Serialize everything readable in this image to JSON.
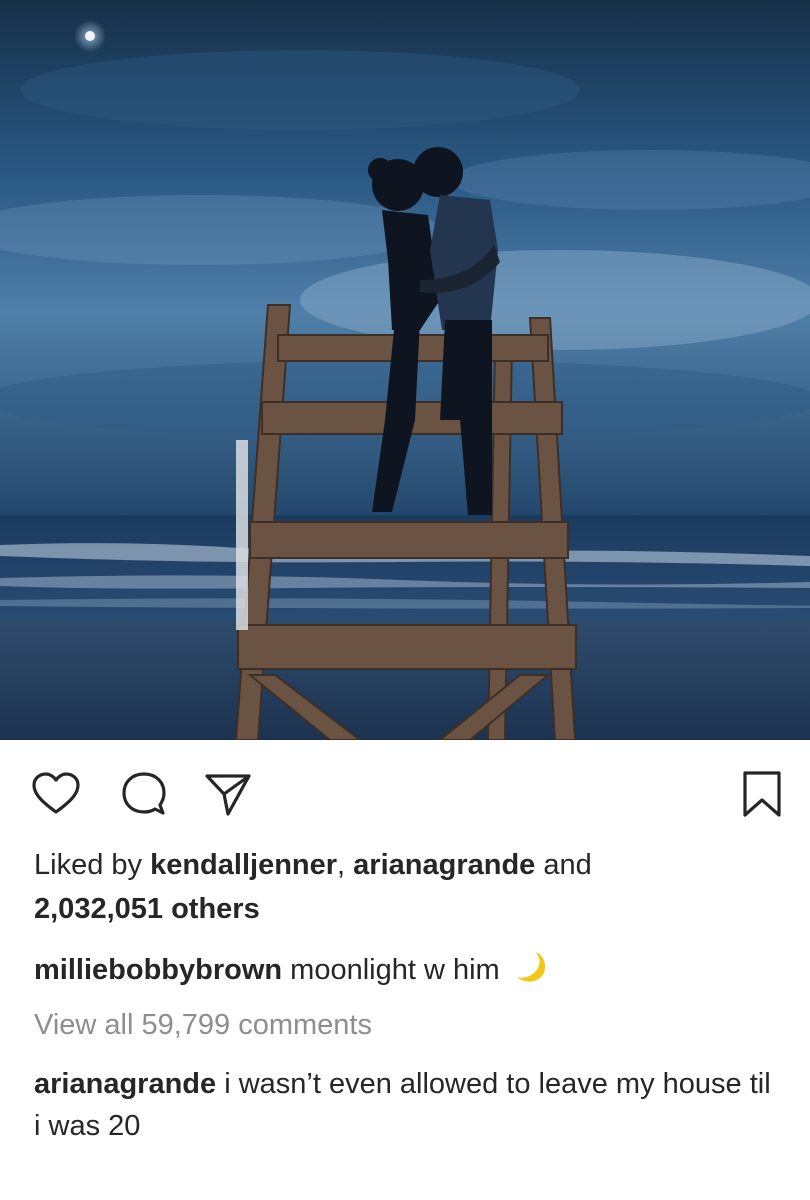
{
  "post": {
    "image_alt": "Couple kissing on a lifeguard chair at the beach under a moonlit sky"
  },
  "actions": {
    "like_icon": "heart-icon",
    "comment_icon": "comment-icon",
    "share_icon": "paper-plane-icon",
    "save_icon": "bookmark-icon"
  },
  "likes": {
    "prefix": "Liked by ",
    "user1": "kendalljenner",
    "separator": ", ",
    "user2": "arianagrande",
    "conjunction": " and",
    "others": "2,032,051 others"
  },
  "caption": {
    "username": "milliebobbybrown",
    "text": " moonlight w him ",
    "emoji": "crescent-moon-icon"
  },
  "view_comments": "View all 59,799 comments",
  "comments": [
    {
      "username": "arianagrande",
      "text": " i wasn’t even allowed to leave my house til i was 20"
    }
  ],
  "colors": {
    "text": "#262626",
    "secondary_text": "#8e8e8e",
    "background": "#ffffff"
  }
}
